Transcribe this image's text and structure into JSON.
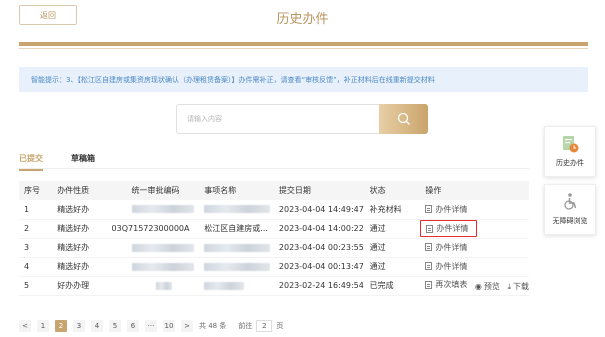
{
  "header": {
    "back_label": "返回",
    "title": "历史办件"
  },
  "notice": {
    "text": "智能提示：3、【松江区自建房或集资房现状确认（办理租赁备案）】办件需补正，请查看“审核反馈”，补正材料后在线重新提交材料"
  },
  "search": {
    "placeholder": "请输入内容",
    "icon": "search-icon"
  },
  "tabs": [
    {
      "label": "已提交",
      "active": true
    },
    {
      "label": "草稿箱",
      "active": false
    }
  ],
  "side": {
    "history_label": "历史办件",
    "history_icon": "history-doc-icon",
    "access_label": "无障碍浏览",
    "access_icon": "wheelchair-icon"
  },
  "colors": {
    "accent": "#c8a46e",
    "notice_text": "#4a86c5",
    "highlight": "#e52c2c"
  },
  "table": {
    "headers": [
      "序号",
      "办件性质",
      "统一审批编码",
      "事项名称",
      "提交日期",
      "状态",
      "操作"
    ],
    "rows": [
      {
        "no": "1",
        "type": "精选好办",
        "code": "",
        "name": "",
        "date": "2023-04-04 14:49:47",
        "status": "补充材料",
        "action": "办件详情"
      },
      {
        "no": "2",
        "type": "精选好办",
        "code": "03Q71572300000A",
        "name": "松江区自建房或...",
        "date": "2023-04-04 14:00:22",
        "status": "通过",
        "action": "办件详情"
      },
      {
        "no": "3",
        "type": "精选好办",
        "code": "",
        "name": "",
        "date": "2023-04-04 00:23:55",
        "status": "通过",
        "action": "办件详情"
      },
      {
        "no": "4",
        "type": "精选好办",
        "code": "",
        "name": "",
        "date": "2023-04-04 00:13:47",
        "status": "通过",
        "action": "办件详情"
      },
      {
        "no": "5",
        "type": "好办办理",
        "code": "",
        "name": "",
        "date": "2023-02-24 16:49:54",
        "status": "已完成",
        "action": "再次填表",
        "action2": "预览",
        "action3": "下载"
      }
    ]
  },
  "pagination": {
    "prev": "<",
    "pages": [
      "1",
      "2",
      "3",
      "4",
      "5",
      "6",
      "···",
      "10"
    ],
    "current": "2",
    "next": ">",
    "total": "共 48 条",
    "goto_label": "前往",
    "goto_value": "2",
    "page_unit": "页"
  }
}
